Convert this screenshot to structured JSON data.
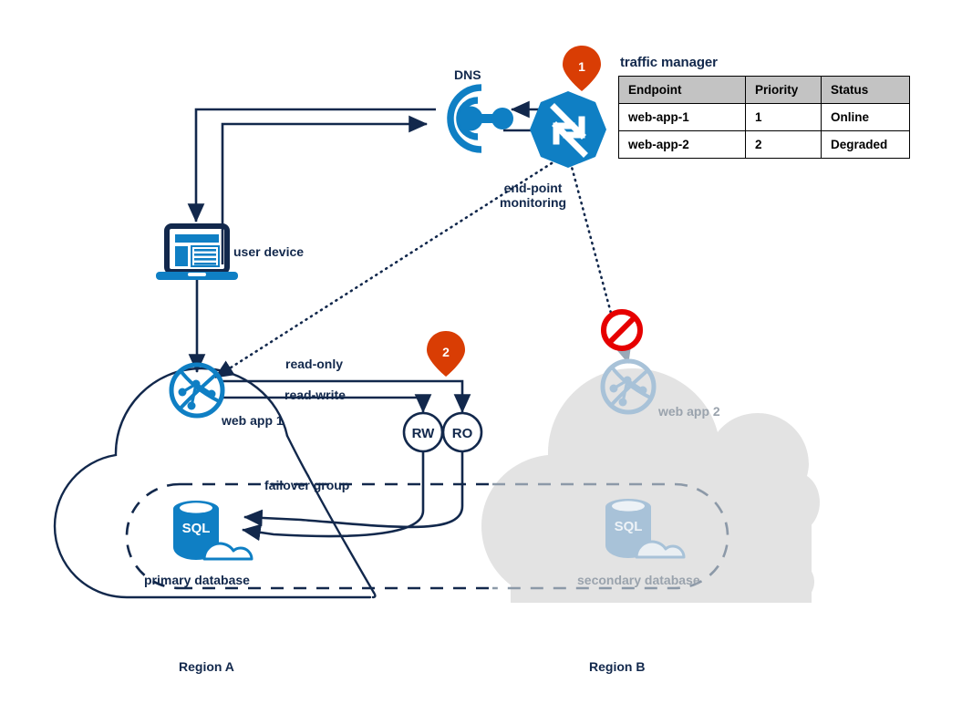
{
  "diagram": {
    "title_region_a": "Region A",
    "title_region_b": "Region B",
    "colors": {
      "azure_blue": "#0f7fc4",
      "navy": "#12284c",
      "orange": "#d93d04",
      "grey_fill": "#e3e3e3",
      "muted_text": "#9aa3ad",
      "faded_icon": "#a8c2d8",
      "online_green": "#00a03c",
      "degraded_red": "#d40000",
      "table_header_grey": "#c3c3c3"
    }
  },
  "traffic_manager": {
    "title": "traffic manager",
    "columns": [
      "Endpoint",
      "Priority",
      "Status"
    ],
    "rows": [
      {
        "endpoint": "web-app-1",
        "priority": "1",
        "status": "Online",
        "status_state": "online"
      },
      {
        "endpoint": "web-app-2",
        "priority": "2",
        "status": "Degraded",
        "status_state": "degraded"
      }
    ]
  },
  "markers": [
    {
      "id": "marker-1",
      "number": "1"
    },
    {
      "id": "marker-2",
      "number": "2"
    }
  ],
  "nodes": {
    "dns": {
      "label": "DNS",
      "icon": "dns-icon"
    },
    "traffic_manager_icon": {
      "label": "",
      "icon": "traffic-manager-icon"
    },
    "user_device": {
      "label": "user device",
      "icon": "laptop-icon"
    },
    "web_app_1": {
      "label": "web app 1",
      "icon": "web-app-icon"
    },
    "web_app_2": {
      "label": "web app 2",
      "icon": "web-app-icon"
    },
    "primary_database": {
      "label": "primary database",
      "icon": "sql-database-icon",
      "badge": "SQL"
    },
    "secondary_database": {
      "label": "secondary database",
      "icon": "sql-database-icon",
      "badge": "SQL"
    },
    "read_write_listener": {
      "label": "RW"
    },
    "read_only_listener": {
      "label": "RO"
    },
    "blocked": {
      "icon": "no-entry-icon"
    }
  },
  "edge_labels": {
    "endpoint_monitoring_line1": "end-point",
    "endpoint_monitoring_line2": "monitoring",
    "read_only": "read-only",
    "read_write": "read-write",
    "failover_group": "failover group"
  }
}
